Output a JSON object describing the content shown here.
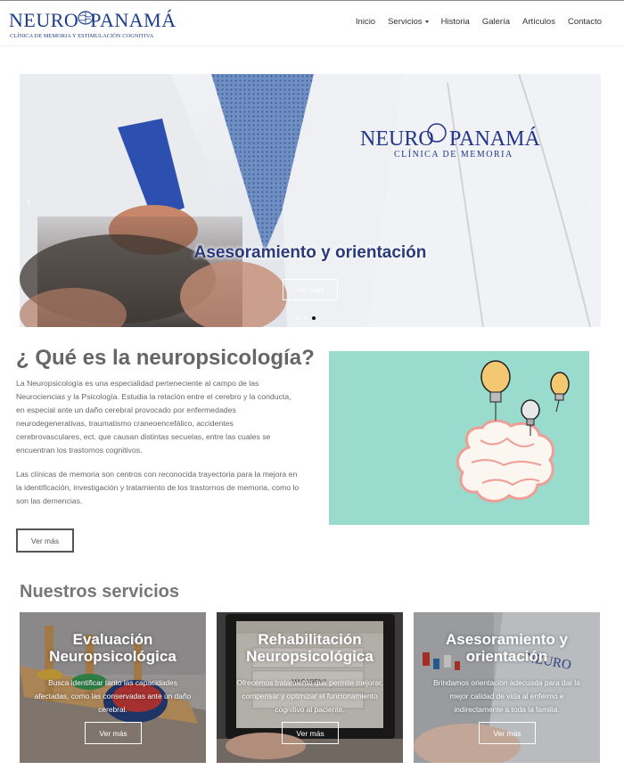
{
  "brand": {
    "name_left": "NEURO",
    "name_right": "PANAMÁ",
    "tagline": "CLÍNICA DE MEMORIA Y ESTIMULACIÓN COGNITIVA"
  },
  "nav": {
    "items": [
      {
        "label": "Inicio"
      },
      {
        "label": "Servicios"
      },
      {
        "label": "Historia"
      },
      {
        "label": "Galería"
      },
      {
        "label": "Artículos"
      },
      {
        "label": "Contacto"
      }
    ]
  },
  "hero": {
    "coat_brand_left": "NEURO",
    "coat_brand_right": "PANAMÁ",
    "coat_tagline": "CLÍNICA DE MEMORIA",
    "title": "Asesoramiento y orientación",
    "button": "Ver más",
    "prev_arrow": "‹",
    "next_arrow": "›",
    "slide_count": 3,
    "active_slide": 3
  },
  "about": {
    "title": "¿ Qué es la neuropsicología?",
    "paragraph1": "La Neuropsicología es una especialidad perteneciente al campo de las Neurociencias y la Psicología. Estudia la relación entre el cerebro y la conducta, en especial ante un daño cerebral provocado por enfermedades neurodegenerativas, traumatismo craneoencefálico, accidentes cerebrovasculares, ect. que causan distintas secuelas, entre las cuales se encuentran los trastornos cognitivos.",
    "paragraph2": "Las clínicas de memoria son centros con reconocida trayectoria para la mejora en la identificación, investigación y tratamiento de los trastornos de memoria, como lo son las demencias.",
    "button": "Ver más"
  },
  "services": {
    "title": "Nuestros servicios",
    "cards": [
      {
        "title": "Evaluación Neuropsicológica",
        "text": "Busca identificar tanto las capacidades afectadas, como las conservadas ante un daño cerebral.",
        "button": "Ver más"
      },
      {
        "title": "Rehabilitación Neuropsicológica",
        "text": "Ofrecemos tratamiento que permite mejorar, compensar y optimizar el funcionamiento cognitivo al paciente.",
        "button": "Ver más",
        "screen_text": "MACARENA"
      },
      {
        "title": "Asesoramiento y orientación",
        "text": "Brindamos orientación adecuada para dar la mejor calidad de vida al enfermo e indirectamente a toda la familia.",
        "button": "Ver más"
      }
    ]
  },
  "colors": {
    "brand_blue": "#1c3d8c",
    "mint": "#99dccd"
  }
}
